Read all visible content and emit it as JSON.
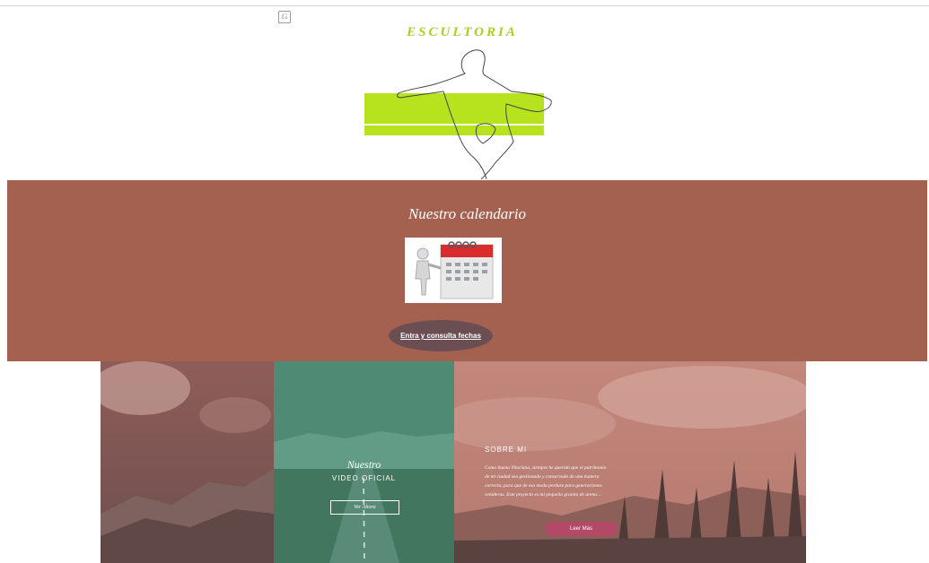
{
  "header": {
    "brand": "ESCULTORIA",
    "icon_name": "image-placeholder-icon",
    "brand_color": "#a6d11e"
  },
  "calendar": {
    "title": "Nuestro calendario",
    "image_name": "calendar-illustration",
    "button_label": "Entra y consulta fechas",
    "background": "#a46150",
    "button_color": "#6b4e52"
  },
  "video": {
    "title": "Nuestro",
    "subtitle": "VIDEO OFICIAL",
    "button_label": "Ver Ahora",
    "panel_color": "#4f8a74"
  },
  "about": {
    "title": "SOBRE MI",
    "text": "Como buena Vitoriana, siempre he querido que el patrimonio de mi ciudad sea gestionado y conservado de una manera correcta, para que de esa moda perdure para generaciones venideras. Este proyecto es mi pequeño granito de arena...",
    "button_label": "Leer Más",
    "button_color": "#b24a67",
    "panel_color": "#c88a7e"
  }
}
